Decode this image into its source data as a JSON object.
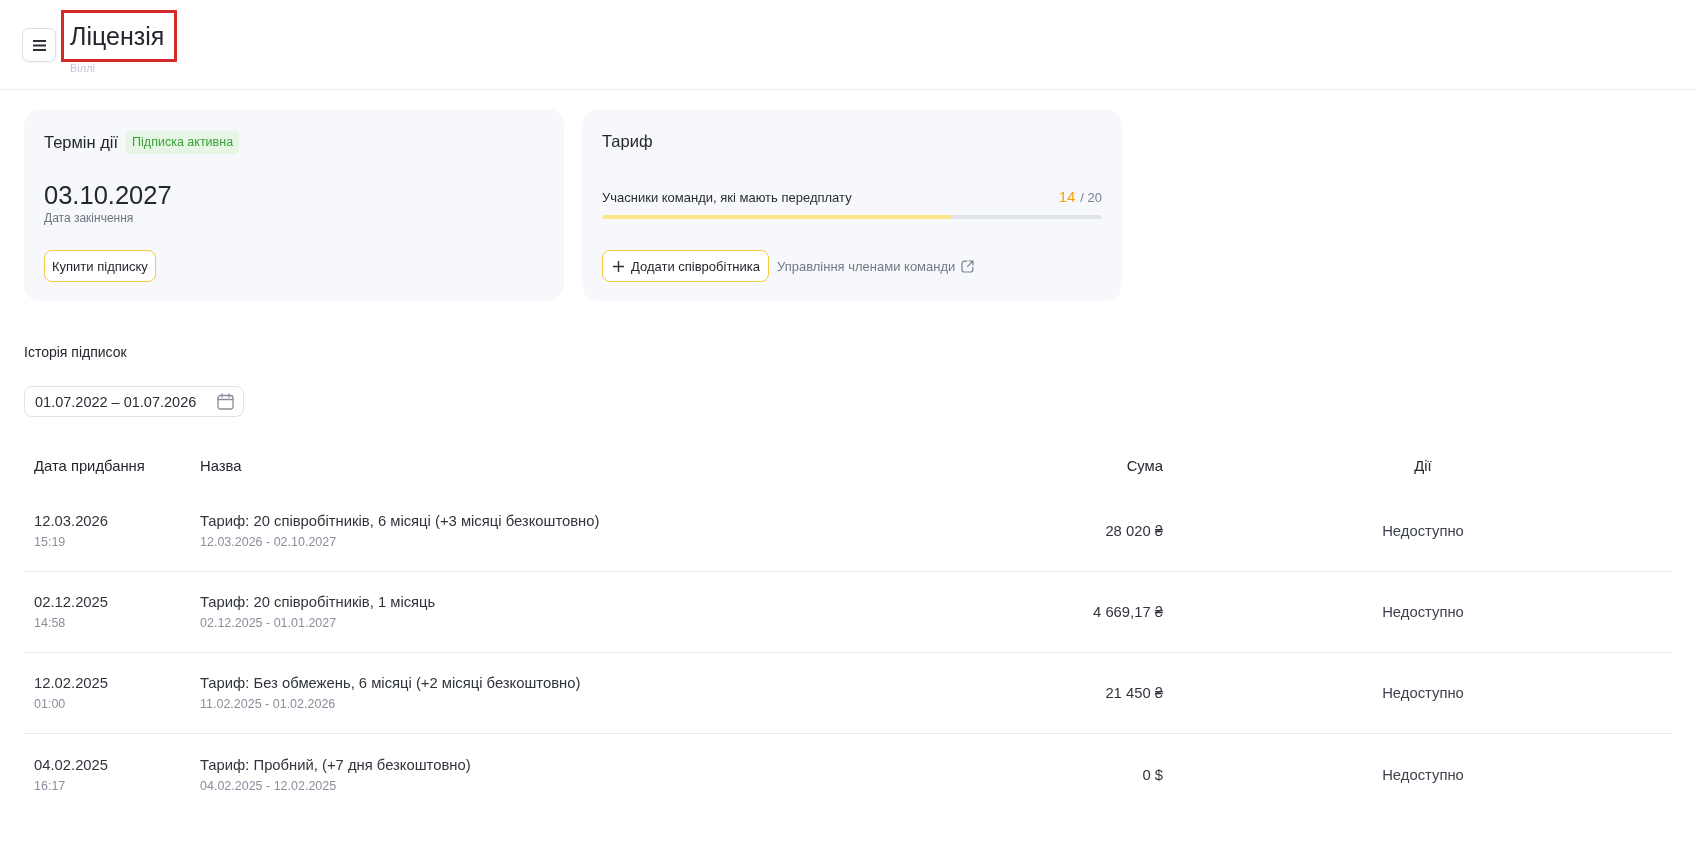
{
  "header": {
    "title": "Ліцензія",
    "highlighted": true,
    "subtitle": "Віллі"
  },
  "validity_card": {
    "title": "Термін дії",
    "badge": {
      "label": "Підписка активна",
      "active": true
    },
    "end_date": "03.10.2027",
    "end_date_label": "Дата закінчення",
    "button": "Купити підписку"
  },
  "plan_card": {
    "title": "Тариф",
    "members": {
      "label": "Учасники команди, які мають передплату",
      "count": "14",
      "total": "/ 20",
      "level": 0.7
    },
    "add_button": "Додати співробітника",
    "manage_link": "Управління членами команди"
  },
  "history": {
    "title": "Історія підписок",
    "date_range": "01.07.2022 – 01.07.2026",
    "columns": [
      "Дата придбання",
      "Назва",
      "Сума",
      "Дії"
    ],
    "rows": [
      {
        "date": "12.03.2026",
        "time": "15:19",
        "name": "Тариф: 20 співробітників, 6 місяці (+3 місяці безкоштовно)",
        "period": "12.03.2026 - 02.10.2027",
        "amount": "28 020 ₴",
        "action": "Недоступно"
      },
      {
        "date": "02.12.2025",
        "time": "14:58",
        "name": "Тариф: 20 співробітників, 1 місяць",
        "period": "02.12.2025 - 01.01.2027",
        "amount": "4 669,17 ₴",
        "action": "Недоступно"
      },
      {
        "date": "12.02.2025",
        "time": "01:00",
        "name": "Тариф: Без обмежень, 6 місяці (+2 місяці безкоштовно)",
        "period": "11.02.2025 - 01.02.2026",
        "amount": "21 450 ₴",
        "action": "Недоступно"
      },
      {
        "date": "04.02.2025",
        "time": "16:17",
        "name": "Тариф: Пробний, (+7 дня безкоштовно)",
        "period": "04.02.2025 - 12.02.2025",
        "amount": "0 $",
        "action": "Недоступно"
      }
    ]
  }
}
